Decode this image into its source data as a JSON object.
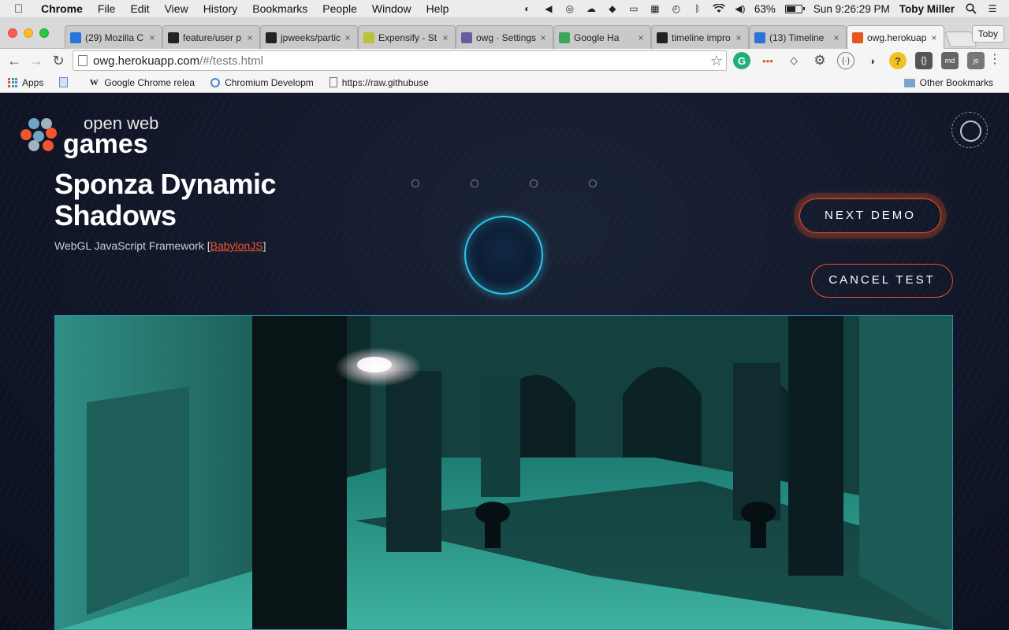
{
  "menubar": {
    "app_name": "Chrome",
    "items": [
      "File",
      "Edit",
      "View",
      "History",
      "Bookmarks",
      "People",
      "Window",
      "Help"
    ],
    "battery_percent": "63%",
    "battery_fraction": 0.63,
    "clock": "Sun 9:26:29 PM",
    "user": "Toby Miller"
  },
  "tabs": [
    {
      "title": "(29) Mozilla C",
      "favicon_color": "#2a74d9"
    },
    {
      "title": "feature/user p",
      "favicon_color": "#222222"
    },
    {
      "title": "jpweeks/partic",
      "favicon_color": "#222222"
    },
    {
      "title": "Expensify - St",
      "favicon_color": "#b9c23a"
    },
    {
      "title": "owg · Settings",
      "favicon_color": "#6b5a9e"
    },
    {
      "title": "Google Ha",
      "favicon_color": "#3ba55c"
    },
    {
      "title": "timeline impro",
      "favicon_color": "#222222"
    },
    {
      "title": "(13) Timeline",
      "favicon_color": "#2a74d9"
    },
    {
      "title": "owg.herokuapp",
      "favicon_color": "#e8541f"
    }
  ],
  "active_tab_index": 8,
  "profile_button": "Toby",
  "toolbar": {
    "url_host": "owg.herokuapp.com",
    "url_path": "/#/tests.html"
  },
  "bookmarks": [
    {
      "label": "Apps"
    },
    {
      "label": "Google Chrome relea"
    },
    {
      "label": "Chromium Developm"
    },
    {
      "label": "https://raw.githubuse"
    }
  ],
  "other_bookmarks": "Other Bookmarks",
  "page": {
    "logo_small": "open web",
    "logo_big": "games",
    "title": "Sponza Dynamic Shadows",
    "subtitle_prefix": "WebGL JavaScript Framework [",
    "subtitle_link": "BabylonJS",
    "subtitle_suffix": "]",
    "next_button": "NEXT DEMO",
    "cancel_button": "CANCEL TEST",
    "progress_steps": 4
  },
  "colors": {
    "accent_orange": "#e8541f",
    "accent_cyan": "#2ec7e8",
    "page_bg": "#111729"
  },
  "icons": [
    "apple-icon",
    "back-icon",
    "forward-icon",
    "reload-icon",
    "star-icon",
    "menu-icon",
    "wifi-icon",
    "volume-icon",
    "search-icon"
  ]
}
